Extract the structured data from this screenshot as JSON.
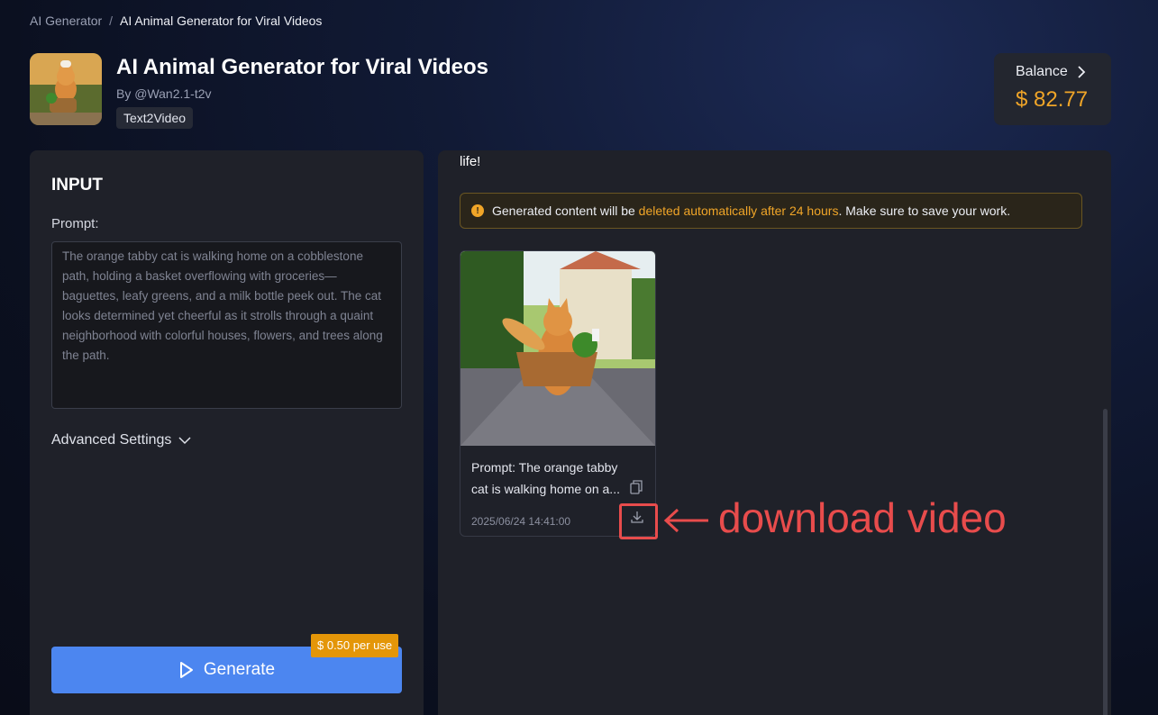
{
  "breadcrumb": {
    "parent": "AI Generator",
    "separator": "/",
    "current": "AI Animal Generator for Viral Videos"
  },
  "header": {
    "title": "AI Animal Generator for Viral Videos",
    "author": "By @Wan2.1-t2v",
    "tag": "Text2Video",
    "icon": "cat-thumbnail"
  },
  "balance": {
    "label": "Balance",
    "value": "$ 82.77",
    "color": "#f0a528"
  },
  "input": {
    "title": "INPUT",
    "prompt_label": "Prompt:",
    "prompt_value": "The orange tabby cat is walking home on a cobblestone path, holding a basket overflowing with groceries—baguettes, leafy greens, and a milk bottle peek out. The cat looks determined yet cheerful as it strolls through a quaint neighborhood with colorful houses, flowers, and trees along the path.",
    "advanced_label": "Advanced Settings",
    "generate_label": "Generate",
    "price": "$ 0.50 per use"
  },
  "output": {
    "top_text": "life!",
    "notice": {
      "before": "Generated content will be ",
      "highlight": "deleted automatically after 24 hours",
      "after": ". Make sure to save your work."
    },
    "video": {
      "prompt": "Prompt: The orange tabby cat is walking home on a...",
      "date": "2025/06/24 14:41:00"
    }
  },
  "annotation": {
    "text": "download video",
    "color": "#e84c4c"
  },
  "colors": {
    "accent": "#4c86f0",
    "warning": "#f0a528",
    "panel": "#1f2129"
  }
}
